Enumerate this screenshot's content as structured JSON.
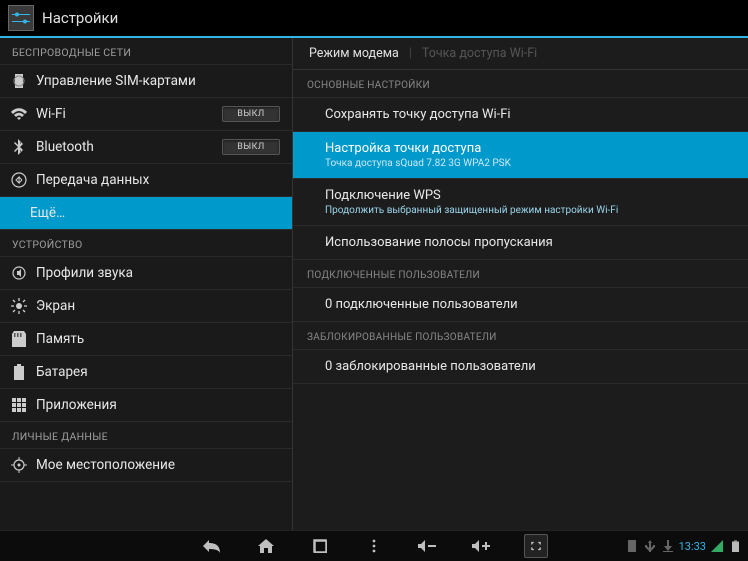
{
  "header": {
    "title": "Настройки"
  },
  "sidebar": {
    "sections": [
      {
        "header": "БЕСПРОВОДНЫЕ СЕТИ",
        "items": [
          {
            "icon": "sim",
            "label": "Управление SIM-картами"
          },
          {
            "icon": "wifi",
            "label": "Wi-Fi",
            "toggle": "ВЫКЛ"
          },
          {
            "icon": "bt",
            "label": "Bluetooth",
            "toggle": "ВЫКЛ"
          },
          {
            "icon": "data",
            "label": "Передача данных"
          },
          {
            "indented": true,
            "label": "Ещё…",
            "selected": true
          }
        ]
      },
      {
        "header": "УСТРОЙСТВО",
        "items": [
          {
            "icon": "sound",
            "label": "Профили звука"
          },
          {
            "icon": "display",
            "label": "Экран"
          },
          {
            "icon": "storage",
            "label": "Память"
          },
          {
            "icon": "battery",
            "label": "Батарея"
          },
          {
            "icon": "apps",
            "label": "Приложения"
          }
        ]
      },
      {
        "header": "ЛИЧНЫЕ ДАННЫЕ",
        "items": [
          {
            "icon": "location",
            "label": "Мое местоположение"
          }
        ]
      }
    ]
  },
  "detail": {
    "tabs": {
      "active": "Режим модема",
      "inactive": "Точка доступа Wi-Fi"
    },
    "sections": [
      {
        "header": "ОСНОВНЫЕ НАСТРОЙКИ",
        "items": [
          {
            "title": "Сохранять точку доступа Wi-Fi"
          },
          {
            "title": "Настройка точки доступа",
            "sub": "Точка доступа sQuad 7.82 3G WPA2 PSK",
            "selected": true
          },
          {
            "title": "Подключение WPS",
            "sub": "Продолжить выбранный защищенный режим настройки Wi-Fi"
          },
          {
            "title": "Использование полосы пропускания"
          }
        ]
      },
      {
        "header": "ПОДКЛЮЧЕННЫЕ ПОЛЬЗОВАТЕЛИ",
        "items": [
          {
            "title": "0 подключенные пользователи"
          }
        ]
      },
      {
        "header": "ЗАБЛОКИРОВАННЫЕ ПОЛЬЗОВАТЕЛИ",
        "items": [
          {
            "title": "0 заблокированные пользователи"
          }
        ]
      }
    ]
  },
  "navbar": {
    "clock": "13:33"
  }
}
